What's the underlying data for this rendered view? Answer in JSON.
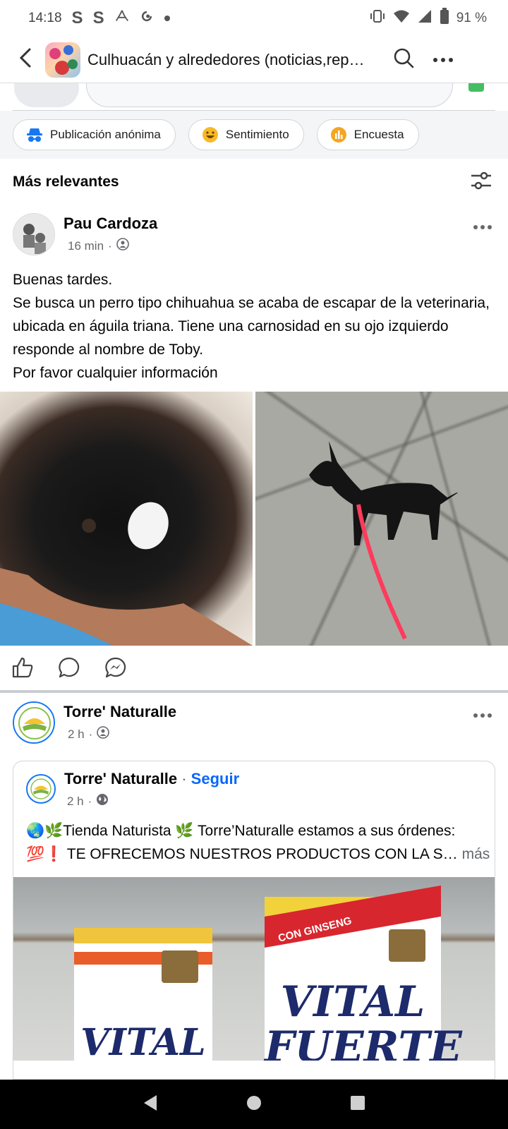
{
  "status_bar": {
    "time": "14:18",
    "notification_icons": [
      "S",
      "S"
    ],
    "battery_percent": "91 %"
  },
  "header": {
    "title": "Culhuacán y alrededores (noticias,rep…"
  },
  "chips": [
    {
      "label": "Publicación anónima",
      "icon": "anonymous-icon"
    },
    {
      "label": "Sentimiento",
      "icon": "emoji-icon"
    },
    {
      "label": "Encuesta",
      "icon": "poll-icon"
    }
  ],
  "sort": {
    "label": "Más relevantes"
  },
  "posts": [
    {
      "author": "Pau Cardoza",
      "time": "16 min",
      "text": "Buenas tardes.\nSe busca un perro tipo chihuahua se acaba de escapar de la veterinaria, ubicada en águila triana. Tiene una carnosidad en su ojo izquierdo  responde al nombre de Toby.\nPor favor cualquier información"
    },
    {
      "author": "Torre' Naturalle",
      "time": "2 h",
      "shared": {
        "author": "Torre' Naturalle",
        "follow": "Seguir",
        "time": "2 h",
        "line1": "🌏🌿Tienda Naturista 🌿 Torre’Naturalle estamos a sus órdenes:",
        "line2": "💯❗️ TE OFRECEMOS NUESTROS PRODUCTOS CON LA S…",
        "more": "más",
        "image_text": {
          "tag": "CON GINSENG",
          "brand_big_1": "VITAL",
          "brand_big_2": "FUERTE",
          "brand_small": "VITAL"
        }
      }
    }
  ],
  "colors": {
    "accent": "#0866ff",
    "chip_anonymous": "#1877f2",
    "chip_feeling": "#f7b928",
    "chip_poll": "#f5a623"
  }
}
